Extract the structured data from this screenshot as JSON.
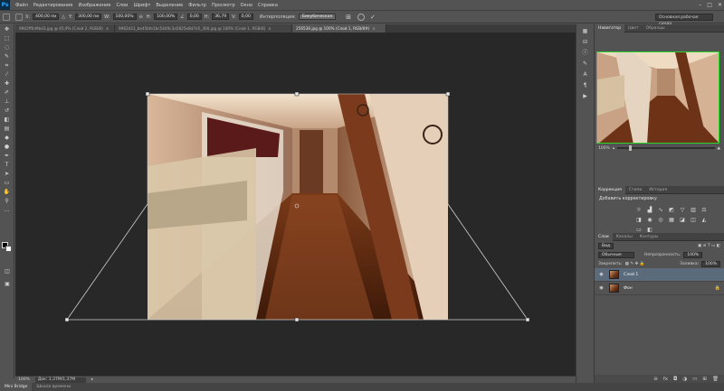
{
  "app": {
    "logo": "Ps"
  },
  "menu": [
    "Файл",
    "Редактирование",
    "Изображение",
    "Слои",
    "Шрифт",
    "Выделение",
    "Фильтр",
    "Просмотр",
    "Окно",
    "Справка"
  ],
  "options": {
    "x_label": "X:",
    "x_value": "400,00 пи",
    "y_label": "Y:",
    "y_value": "300,00 пи",
    "w_label": "W:",
    "w_value": "100,00%",
    "h_label": "H:",
    "h_value": "100,00%",
    "angle_value": "0,00",
    "hskew_label": "H:",
    "hskew_value": "36,79",
    "vskew_label": "V:",
    "vskew_value": "0,00",
    "interp_label": "Интерполяция:",
    "interp_value": "Бикубическая",
    "workspace": "Основная рабочая среда"
  },
  "tabs": [
    {
      "label": "9962ff6d9bd3.jpg @ 45,9% (Слой 2, RGB/8)",
      "active": false
    },
    {
      "label": "9962d21_be45bfe1bc5449c3a5825e8d7e5_300.jpg @ 100% (Слой 1, RGB/8)",
      "active": false
    },
    {
      "label": "256536.jpg @ 100% (Слой 1, RGB/8#)",
      "active": true
    }
  ],
  "status": {
    "zoom": "100%",
    "doc": "Док: 1,37М/1,37М"
  },
  "bottom_tabs": [
    "Mini Bridge",
    "Шкала времени"
  ],
  "navigator": {
    "tabs": [
      "Навигатор",
      "Цвет",
      "Образцы"
    ],
    "zoom": "100%"
  },
  "adjustments": {
    "tabs": [
      "Коррекция",
      "Стили",
      "История"
    ],
    "title": "Добавить корректировку"
  },
  "layers": {
    "tabs": [
      "Слои",
      "Каналы",
      "Контуры"
    ],
    "kind": "Вид",
    "blend": "Обычные",
    "opacity_label": "Непрозрачность:",
    "opacity": "100%",
    "lock_label": "Закрепить:",
    "fill_label": "Заливка:",
    "fill": "100%",
    "items": [
      {
        "name": "Слой 1",
        "selected": true
      },
      {
        "name": "Фон",
        "selected": false
      }
    ]
  }
}
